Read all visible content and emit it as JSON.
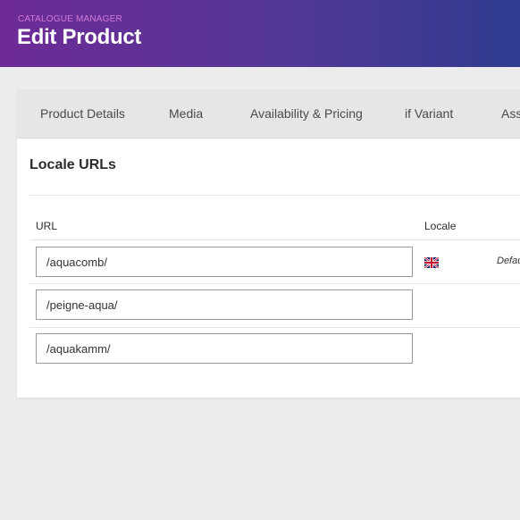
{
  "header": {
    "section_label": "CATALOGUE MANAGER",
    "title": "Edit Product"
  },
  "tabs": [
    {
      "label": "Product Details"
    },
    {
      "label": "Media"
    },
    {
      "label": "Availability & Pricing"
    },
    {
      "label": "if Variant"
    },
    {
      "label": "Ass"
    }
  ],
  "panel": {
    "title": "Locale URLs",
    "columns": {
      "url": "URL",
      "locale": "Locale"
    },
    "rows": [
      {
        "url": "/aquacomb/",
        "locale_icon": "uk-flag-icon",
        "default_label": "Defau"
      },
      {
        "url": "/peigne-aqua/"
      },
      {
        "url": "/aquakamm/"
      }
    ]
  },
  "colors": {
    "header_gradient_start": "#6e2a97",
    "header_gradient_end": "#2f3c8f",
    "section_label": "#d07ad6",
    "background": "#ececec",
    "tabbar": "#e6e6e6"
  }
}
